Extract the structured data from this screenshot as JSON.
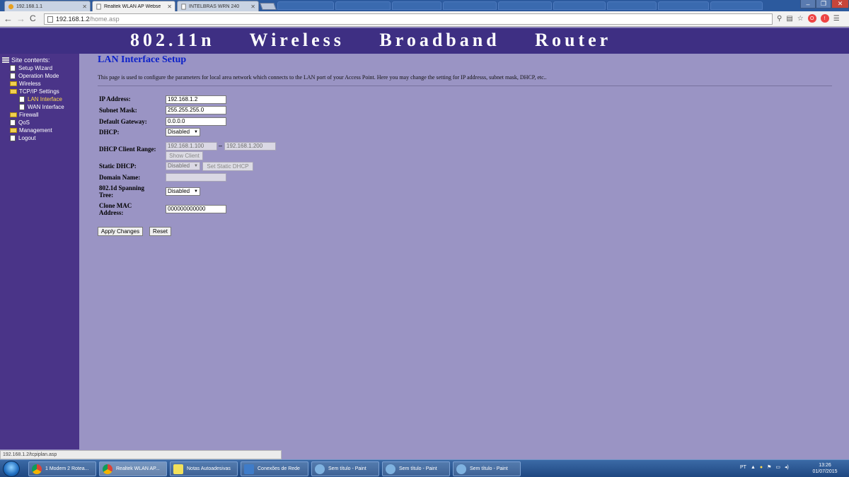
{
  "browser": {
    "tabs": [
      {
        "label": "192.168.1.1",
        "active": false
      },
      {
        "label": "Realtek WLAN AP Webse",
        "active": true
      },
      {
        "label": "INTELBRAS WRN 240",
        "active": false
      }
    ],
    "url_host": "192.168.1.2",
    "url_path": "/home.asp",
    "status_url": "192.168.1.2/tcpiplan.asp"
  },
  "router": {
    "banner": "802.11n Wireless Broadband Router"
  },
  "sidebar": {
    "heading": "Site contents:",
    "items": [
      {
        "label": "Setup Wizard",
        "type": "page",
        "level": 1
      },
      {
        "label": "Operation Mode",
        "type": "page",
        "level": 1
      },
      {
        "label": "Wireless",
        "type": "folder",
        "level": 1
      },
      {
        "label": "TCP/IP Settings",
        "type": "folder-open",
        "level": 1
      },
      {
        "label": "LAN Interface",
        "type": "page",
        "level": 2,
        "selected": true
      },
      {
        "label": "WAN Interface",
        "type": "page",
        "level": 2
      },
      {
        "label": "Firewall",
        "type": "folder",
        "level": 1
      },
      {
        "label": "QoS",
        "type": "page",
        "level": 1
      },
      {
        "label": "Management",
        "type": "folder",
        "level": 1
      },
      {
        "label": "Logout",
        "type": "page",
        "level": 1
      }
    ]
  },
  "page": {
    "title": "LAN Interface Setup",
    "description": "This page is used to configure the parameters for local area network which connects to the LAN port of your Access Point. Here you may change the setting for IP addresss, subnet mask, DHCP, etc..",
    "fields": {
      "ip_address": {
        "label": "IP Address:",
        "value": "192.168.1.2"
      },
      "subnet_mask": {
        "label": "Subnet Mask:",
        "value": "255.255.255.0"
      },
      "default_gateway": {
        "label": "Default Gateway:",
        "value": "0.0.0.0"
      },
      "dhcp": {
        "label": "DHCP:",
        "value": "Disabled"
      },
      "dhcp_range": {
        "label": "DHCP Client Range:",
        "start": "192.168.1.100",
        "separator": "–",
        "end": "192.168.1.200",
        "show_client": "Show Client"
      },
      "static_dhcp": {
        "label": "Static DHCP:",
        "value": "Disabled",
        "button": "Set Static DHCP"
      },
      "domain_name": {
        "label": "Domain Name:",
        "value": ""
      },
      "spanning_tree": {
        "label_line1": "802.1d Spanning",
        "label_line2": "Tree:",
        "value": "Disabled"
      },
      "clone_mac": {
        "label_line1": "Clone MAC",
        "label_line2": "Address:",
        "value": "000000000000"
      }
    },
    "apply_label": "Apply Changes",
    "reset_label": "Reset"
  },
  "taskbar": {
    "items": [
      {
        "label": "1 Modem 2 Rotea...",
        "color": "#e0a020"
      },
      {
        "label": "Realtek WLAN AP...",
        "color": "#e0a020"
      },
      {
        "label": "Notas Autoadesivas",
        "color": "#f2e15b"
      },
      {
        "label": "Conexões de Rede",
        "color": "#3f7cc9"
      },
      {
        "label": "Sem título - Paint",
        "color": "#7fb2e0"
      },
      {
        "label": "Sem título - Paint",
        "color": "#7fb2e0"
      },
      {
        "label": "Sem título - Paint",
        "color": "#7fb2e0"
      }
    ],
    "lang": "PT",
    "time": "13:26",
    "date": "01/07/2015"
  }
}
